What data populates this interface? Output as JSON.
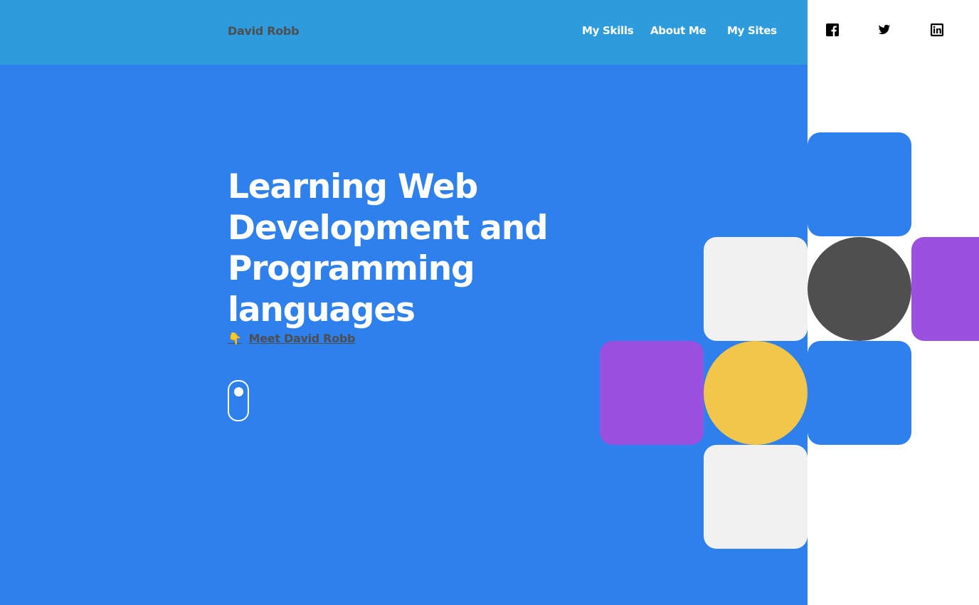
{
  "header": {
    "brand": "David Robb",
    "nav": [
      {
        "label": "My Skills"
      },
      {
        "label": "About Me"
      },
      {
        "label": "My Sites"
      }
    ]
  },
  "social": [
    {
      "icon": "facebook-icon"
    },
    {
      "icon": "twitter-icon"
    },
    {
      "icon": "linkedin-icon"
    }
  ],
  "hero": {
    "title": "Learning Web Development and Programming languages",
    "meet_label": "Meet David Robb",
    "meet_icon": "👇"
  },
  "colors": {
    "background": "#2e80ec",
    "header": "#2e9bdd",
    "panel": "#ffffff",
    "blue_tile": "#2e80ec",
    "gray_tile": "#f1f1f1",
    "purple_tile": "#9b51e0",
    "yellow_circle": "#f2c54b",
    "dark_circle": "#4f4f4f",
    "text_dark": "#4e4e4e"
  }
}
